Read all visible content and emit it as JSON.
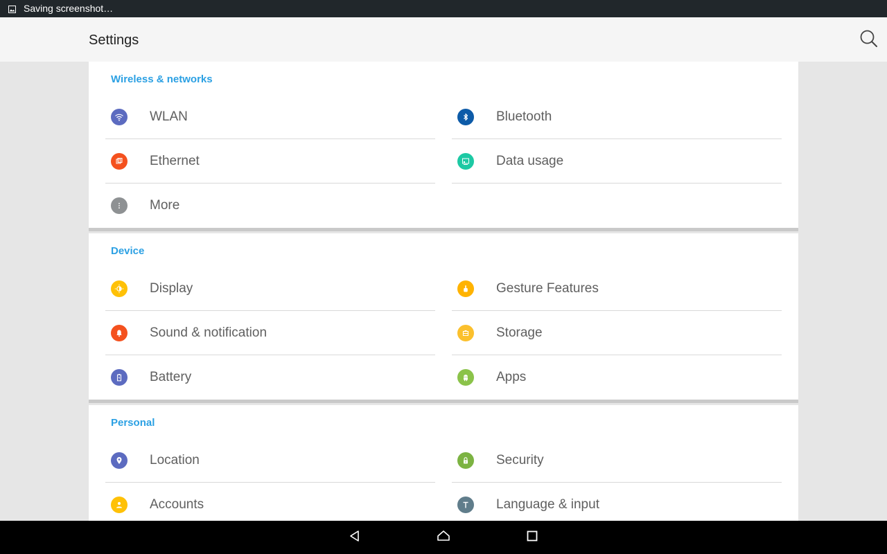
{
  "status_bar": {
    "notification": "Saving screenshot…",
    "icon": "image-icon"
  },
  "app_bar": {
    "title": "Settings",
    "search_icon": "search-icon"
  },
  "sections": [
    {
      "header": "Wireless & networks",
      "items": [
        {
          "label": "WLAN",
          "icon": "wifi-icon",
          "color": "#5c6bc0"
        },
        {
          "label": "Bluetooth",
          "icon": "bluetooth-icon",
          "color": "#0d5ba8"
        },
        {
          "label": "Ethernet",
          "icon": "ethernet-icon",
          "color": "#f4511e"
        },
        {
          "label": "Data usage",
          "icon": "data-usage-icon",
          "color": "#1dc9a4"
        },
        {
          "label": "More",
          "icon": "more-icon",
          "color": "#8e9193"
        }
      ]
    },
    {
      "header": "Device",
      "items": [
        {
          "label": "Display",
          "icon": "display-icon",
          "color": "#ffc107"
        },
        {
          "label": "Gesture Features",
          "icon": "gesture-icon",
          "color": "#ffb300"
        },
        {
          "label": "Sound & notification",
          "icon": "bell-icon",
          "color": "#f4511e"
        },
        {
          "label": "Storage",
          "icon": "storage-icon",
          "color": "#fbc02d"
        },
        {
          "label": "Battery",
          "icon": "battery-icon",
          "color": "#5c6bc0"
        },
        {
          "label": "Apps",
          "icon": "android-icon",
          "color": "#8bc34a"
        }
      ]
    },
    {
      "header": "Personal",
      "items": [
        {
          "label": "Location",
          "icon": "location-icon",
          "color": "#5c6bc0"
        },
        {
          "label": "Security",
          "icon": "lock-icon",
          "color": "#7cb342"
        },
        {
          "label": "Accounts",
          "icon": "account-icon",
          "color": "#ffc107"
        },
        {
          "label": "Language & input",
          "icon": "language-icon",
          "color": "#607d8b"
        }
      ]
    }
  ],
  "nav_bar": {
    "back_icon": "back-icon",
    "home_icon": "home-icon",
    "recents_icon": "recents-icon"
  }
}
